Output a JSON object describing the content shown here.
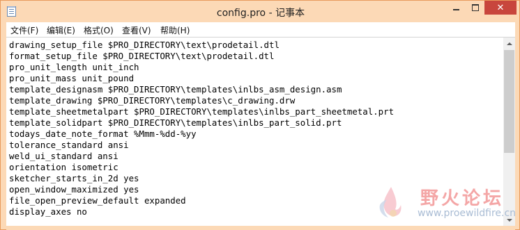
{
  "window": {
    "title": "config.pro - 记事本",
    "minimize_label": "",
    "maximize_label": "",
    "close_label": "✕",
    "frame_color": "#fcd9b6",
    "close_color": "#c8463d"
  },
  "menu": {
    "file": "文件(F)",
    "edit": "编辑(E)",
    "format": "格式(O)",
    "view": "查看(V)",
    "help": "帮助(H)"
  },
  "editor": {
    "content": "drawing_setup_file $PRO_DIRECTORY\\text\\prodetail.dtl\nformat_setup_file $PRO_DIRECTORY\\text\\prodetail.dtl\npro_unit_length unit_inch\npro_unit_mass unit_pound\ntemplate_designasm $PRO_DIRECTORY\\templates\\inlbs_asm_design.asm\ntemplate_drawing $PRO_DIRECTORY\\templates\\c_drawing.drw\ntemplate_sheetmetalpart $PRO_DIRECTORY\\templates\\inlbs_part_sheetmetal.prt\ntemplate_solidpart $PRO_DIRECTORY\\templates\\inlbs_part_solid.prt\ntodays_date_note_format %Mmm-%dd-%yy\ntolerance_standard ansi\nweld_ui_standard ansi\norientation isometric\nsketcher_starts_in_2d yes\nopen_window_maximized yes\nfile_open_preview_default expanded\ndisplay_axes no"
  },
  "watermark": {
    "name": "野火论坛",
    "url": "www.proewildfire.cn"
  }
}
